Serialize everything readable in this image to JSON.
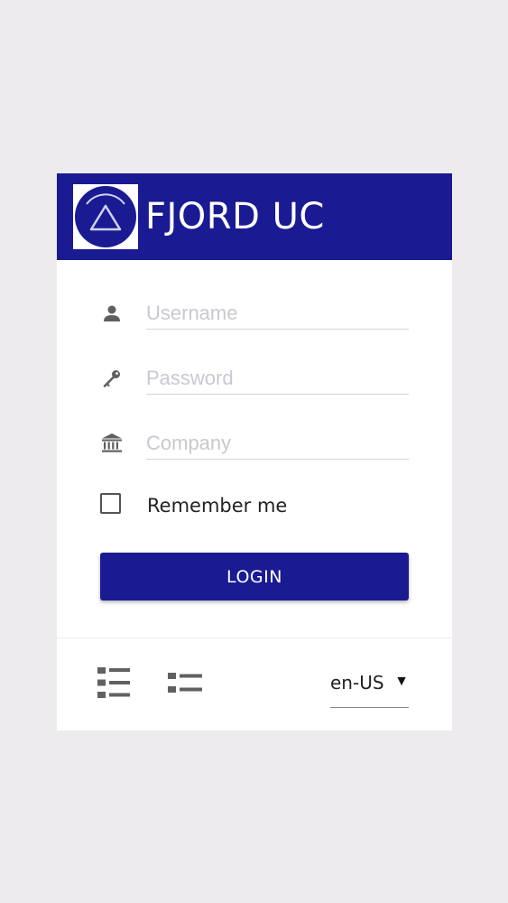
{
  "header": {
    "brand": "FJORD UC",
    "brand_color": "#1a1a93"
  },
  "form": {
    "username": {
      "placeholder": "Username",
      "value": "",
      "icon": "user-icon"
    },
    "password": {
      "placeholder": "Password",
      "value": "",
      "icon": "key-icon"
    },
    "company": {
      "placeholder": "Company",
      "value": "",
      "icon": "bank-icon"
    },
    "remember_label": "Remember me",
    "remember_checked": false,
    "login_label": "LOGIN"
  },
  "footer": {
    "icons": [
      "list-detailed-icon",
      "list-compact-icon"
    ],
    "language": "en-US",
    "language_arrow": "▼"
  }
}
